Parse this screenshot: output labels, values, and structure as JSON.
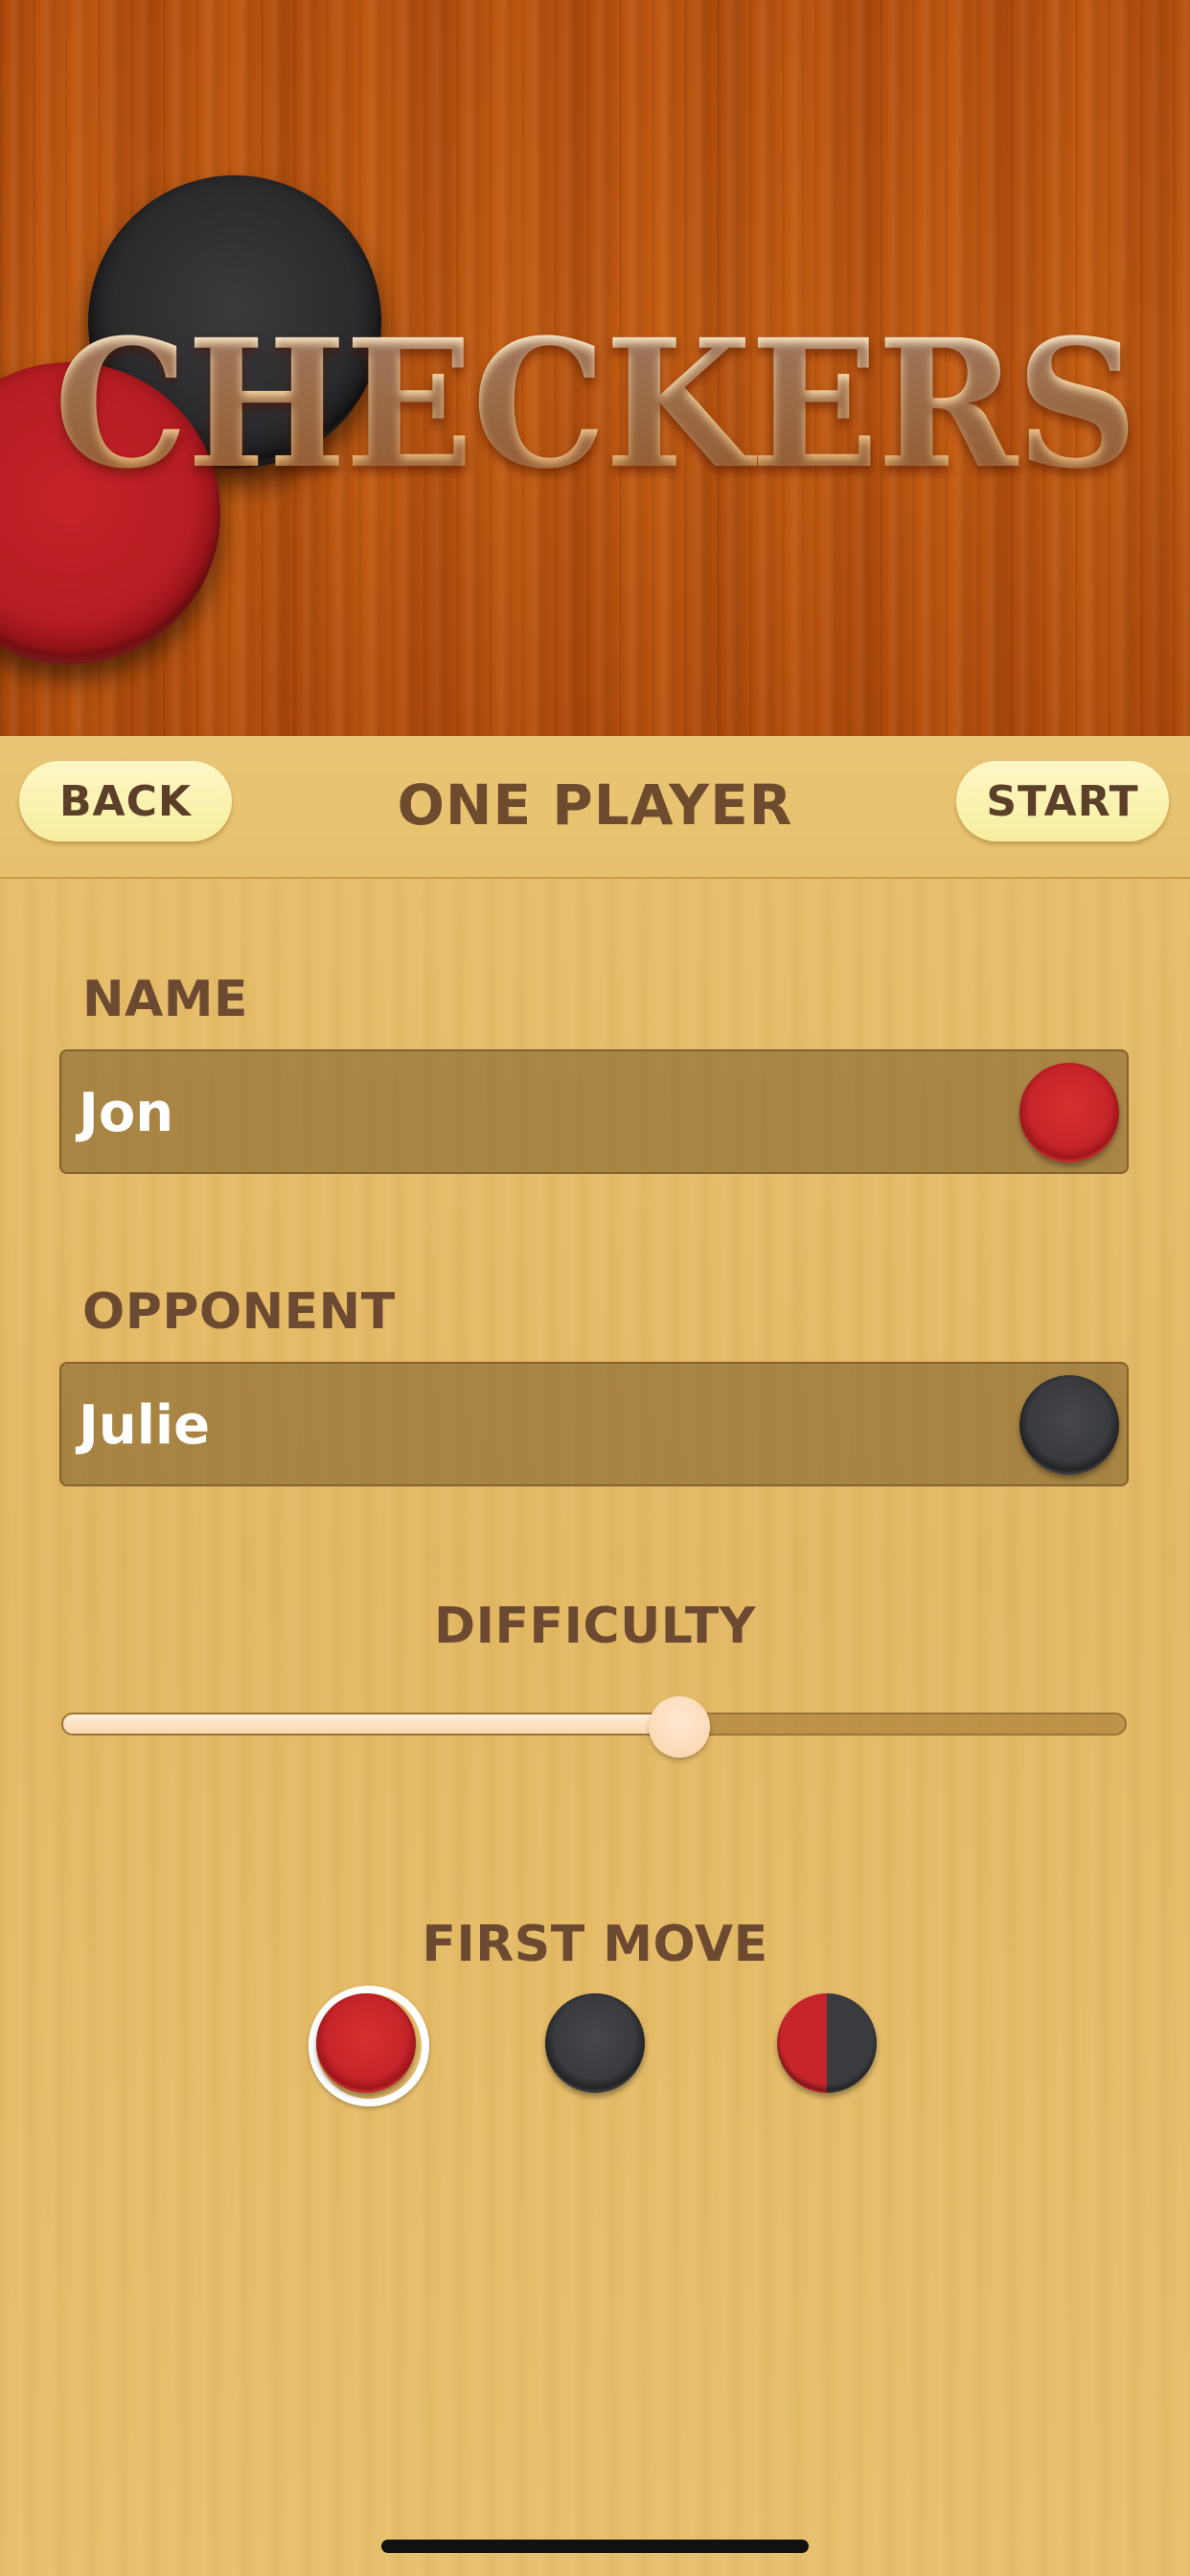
{
  "app": {
    "title": "CHECKERS"
  },
  "navbar": {
    "back_label": "BACK",
    "title": "ONE PLAYER",
    "start_label": "START"
  },
  "form": {
    "name_label": "NAME",
    "name_value": "Jon",
    "name_piece": "red",
    "opponent_label": "OPPONENT",
    "opponent_value": "Julie",
    "opponent_piece": "black",
    "difficulty_label": "DIFFICULTY",
    "difficulty_level": 0.58,
    "first_move_label": "FIRST MOVE",
    "first_move_options": [
      "red",
      "black",
      "random"
    ],
    "first_move_selected": "red"
  },
  "colors": {
    "red_piece": "#c5242a",
    "black_piece": "#393b3f",
    "label_brown": "#6b4a31",
    "pill_yellow": "#fbf3b2"
  }
}
